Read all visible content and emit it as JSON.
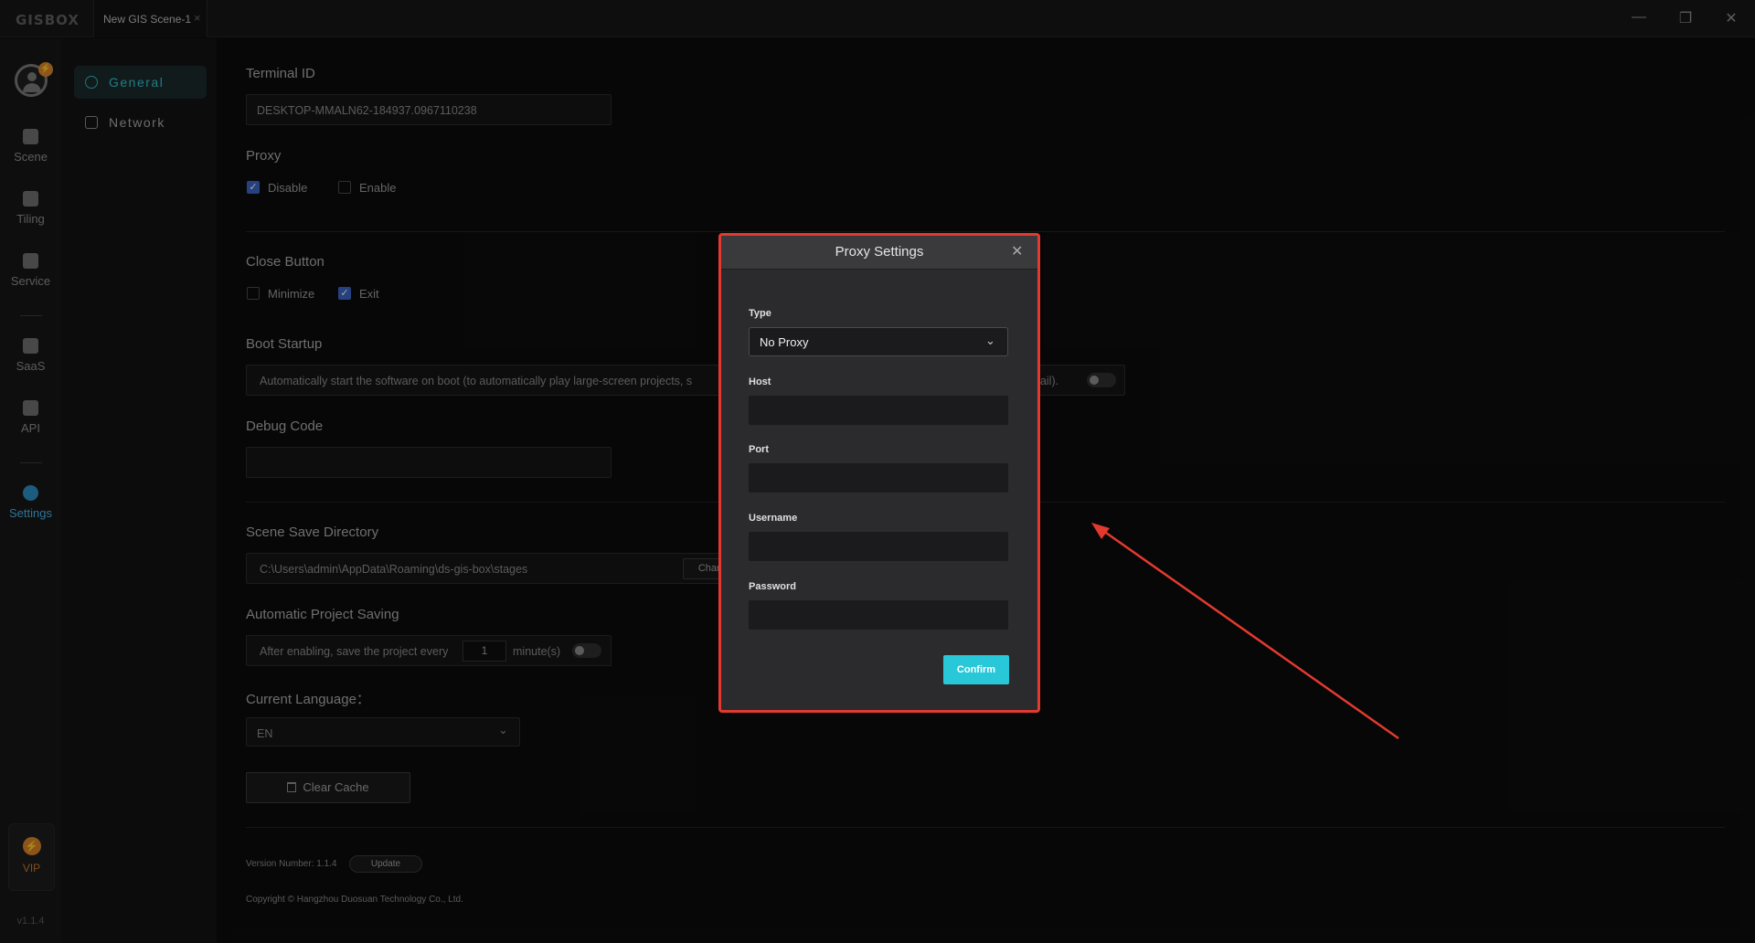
{
  "app": {
    "logo": "GISBOX",
    "tab_title": "New GIS Scene-1",
    "tab_close": "×",
    "win_minimize": "—",
    "win_restore": "❐",
    "win_close": "✕"
  },
  "leftbar": {
    "avatar_badge": "⚡",
    "items": [
      {
        "label": "Scene",
        "icon": "scene-icon"
      },
      {
        "label": "Tiling",
        "icon": "tiling-icon"
      },
      {
        "label": "Service",
        "icon": "service-icon"
      },
      {
        "label": "SaaS",
        "icon": "saas-icon"
      },
      {
        "label": "API",
        "icon": "api-icon"
      },
      {
        "label": "Settings",
        "icon": "settings-icon"
      }
    ],
    "active": "Settings",
    "vip_label": "VIP",
    "vip_icon_glyph": "⚡",
    "version": "v1.1.4"
  },
  "subnav": {
    "items": [
      {
        "label": "General"
      },
      {
        "label": "Network"
      }
    ],
    "active": "General"
  },
  "settings": {
    "terminal_id_label": "Terminal ID",
    "terminal_id_value": "DESKTOP-MMALN62-184937.0967110238",
    "proxy_label": "Proxy",
    "proxy_disable": "Disable",
    "proxy_enable": "Enable",
    "close_button_label": "Close Button",
    "close_minimize": "Minimize",
    "close_exit": "Exit",
    "boot_startup_label": "Boot Startup",
    "boot_startup_text_left": "Automatically start the software on boot (to automatically play large-screen projects, s",
    "boot_startup_text_right": "nail).",
    "debug_code_label": "Debug Code",
    "debug_code_value": "",
    "scene_dir_label": "Scene Save Directory",
    "scene_dir_value": "C:\\Users\\admin\\AppData\\Roaming\\ds-gis-box\\stages",
    "scene_dir_button": "Chan",
    "auto_save_label": "Automatic Project Saving",
    "auto_save_prefix": "After enabling, save the project every",
    "auto_save_minutes": "1",
    "auto_save_suffix": "minute(s)",
    "language_label": "Current Language：",
    "language_value": "EN",
    "clear_cache": "Clear Cache",
    "version_text": "Version Number: 1.1.4",
    "update_button": "Update",
    "copyright": "Copyright © Hangzhou Duosuan Technology Co., Ltd.",
    "check_mark": "✓",
    "chevron": "⌄"
  },
  "modal": {
    "title": "Proxy Settings",
    "close_glyph": "✕",
    "type_label": "Type",
    "type_value": "No Proxy",
    "host_label": "Host",
    "host_value": "",
    "port_label": "Port",
    "port_value": "",
    "username_label": "Username",
    "username_value": "",
    "password_label": "Password",
    "password_value": "",
    "confirm": "Confirm",
    "highlight_color": "#e23a2e",
    "accent_color": "#28c8d9"
  }
}
